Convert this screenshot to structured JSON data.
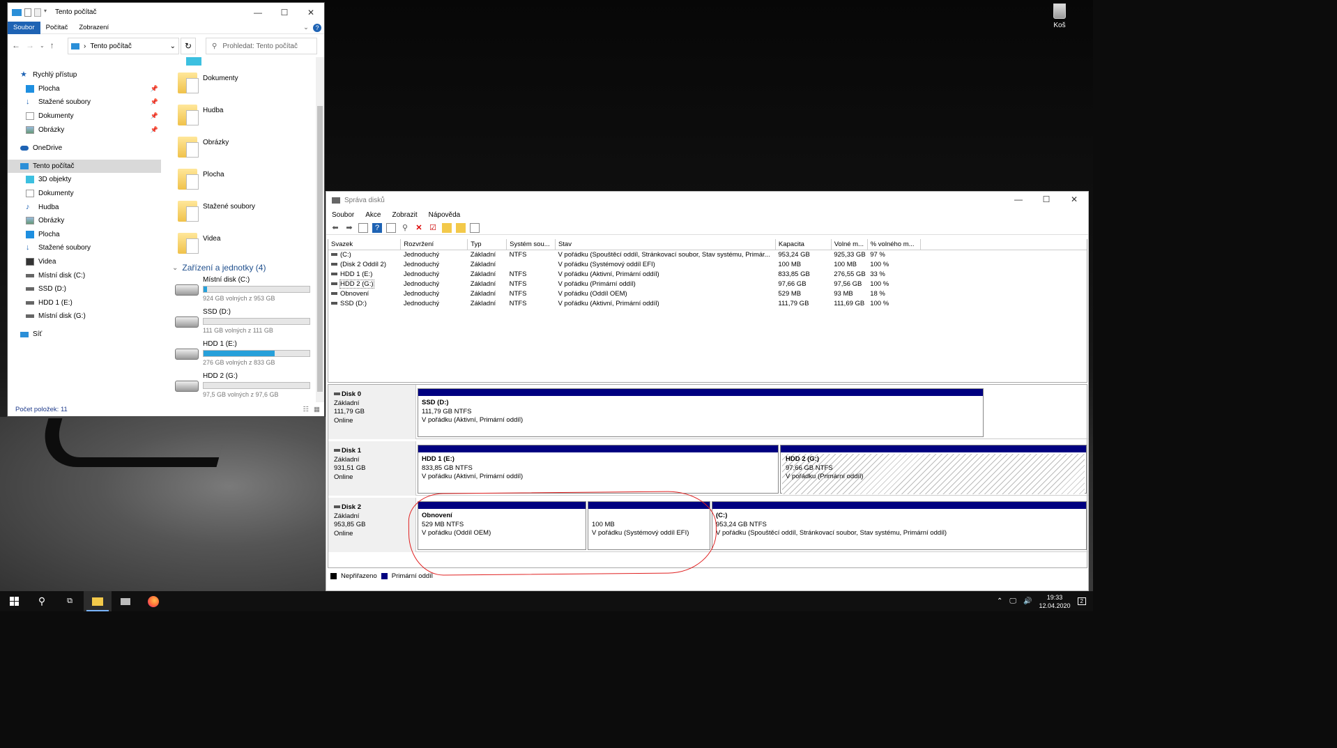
{
  "desktop": {
    "recycle_label": "Koš"
  },
  "explorer": {
    "title": "Tento počítač",
    "ribbon_tabs": [
      "Soubor",
      "Počítač",
      "Zobrazení"
    ],
    "address": "Tento počítač",
    "search_placeholder": "Prohledat: Tento počítač",
    "nav": {
      "quick_access": "Rychlý přístup",
      "quick_items": [
        "Plocha",
        "Stažené soubory",
        "Dokumenty",
        "Obrázky"
      ],
      "onedrive": "OneDrive",
      "this_pc": "Tento počítač",
      "pc_items": [
        "3D objekty",
        "Dokumenty",
        "Hudba",
        "Obrázky",
        "Plocha",
        "Stažené soubory",
        "Videa",
        "Místní disk (C:)",
        "SSD (D:)",
        "HDD 1 (E:)",
        "Místní disk (G:)"
      ],
      "network": "Síť"
    },
    "folders": [
      "Dokumenty",
      "Hudba",
      "Obrázky",
      "Plocha",
      "Stažené soubory",
      "Videa"
    ],
    "devices_header": "Zařízení a jednotky (4)",
    "drives": [
      {
        "name": "Místní disk (C:)",
        "free": "924 GB volných z 953 GB",
        "used_fraction": 0.03
      },
      {
        "name": "SSD (D:)",
        "free": "111 GB volných z 111 GB",
        "used_fraction": 0.0
      },
      {
        "name": "HDD 1 (E:)",
        "free": "276 GB volných z 833 GB",
        "used_fraction": 0.67
      },
      {
        "name": "HDD 2 (G:)",
        "free": "97,5 GB volných z 97,6 GB",
        "used_fraction": 0.0
      }
    ],
    "status": "Počet položek: 11"
  },
  "diskmgmt": {
    "title": "Správa disků",
    "menu": [
      "Soubor",
      "Akce",
      "Zobrazit",
      "Nápověda"
    ],
    "columns": [
      "Svazek",
      "Rozvržení",
      "Typ",
      "Systém sou...",
      "Stav",
      "Kapacita",
      "Volné m...",
      "% volného m..."
    ],
    "rows": [
      [
        "(C:)",
        "Jednoduchý",
        "Základní",
        "NTFS",
        "V pořádku (Spouštěcí oddíl, Stránkovací soubor, Stav systému, Primár...",
        "953,24 GB",
        "925,33 GB",
        "97 %"
      ],
      [
        "(Disk 2 Oddíl 2)",
        "Jednoduchý",
        "Základní",
        "",
        "V pořádku (Systémový oddíl EFI)",
        "100 MB",
        "100 MB",
        "100 %"
      ],
      [
        "HDD 1 (E:)",
        "Jednoduchý",
        "Základní",
        "NTFS",
        "V pořádku (Aktivní, Primární oddíl)",
        "833,85 GB",
        "276,55 GB",
        "33 %"
      ],
      [
        "HDD 2 (G:)",
        "Jednoduchý",
        "Základní",
        "NTFS",
        "V pořádku (Primární oddíl)",
        "97,66 GB",
        "97,56 GB",
        "100 %"
      ],
      [
        "Obnovení",
        "Jednoduchý",
        "Základní",
        "NTFS",
        "V pořádku (Oddíl OEM)",
        "529 MB",
        "93 MB",
        "18 %"
      ],
      [
        "SSD (D:)",
        "Jednoduchý",
        "Základní",
        "NTFS",
        "V pořádku (Aktivní, Primární oddíl)",
        "111,79 GB",
        "111,69 GB",
        "100 %"
      ]
    ],
    "disks": [
      {
        "name": "Disk 0",
        "type": "Základní",
        "size": "111,79 GB",
        "state": "Online",
        "parts": [
          {
            "title": "SSD  (D:)",
            "size": "111,79 GB NTFS",
            "status": "V pořádku (Aktivní, Primární oddíl)"
          }
        ]
      },
      {
        "name": "Disk 1",
        "type": "Základní",
        "size": "931,51 GB",
        "state": "Online",
        "parts": [
          {
            "title": "HDD 1  (E:)",
            "size": "833,85 GB NTFS",
            "status": "V pořádku (Aktivní, Primární oddíl)"
          },
          {
            "title": "HDD 2  (G:)",
            "size": "97,66 GB NTFS",
            "status": "V pořádku (Primární oddíl)"
          }
        ]
      },
      {
        "name": "Disk 2",
        "type": "Základní",
        "size": "953,85 GB",
        "state": "Online",
        "parts": [
          {
            "title": "Obnovení",
            "size": "529 MB NTFS",
            "status": "V pořádku (Oddíl OEM)"
          },
          {
            "title": "",
            "size": "100 MB",
            "status": "V pořádku (Systémový oddíl EFI)"
          },
          {
            "title": "(C:)",
            "size": "953,24 GB NTFS",
            "status": "V pořádku (Spouštěcí oddíl, Stránkovací soubor, Stav systému, Primární oddíl)"
          }
        ]
      }
    ],
    "legend": [
      "Nepřiřazeno",
      "Primární oddíl"
    ],
    "colors": {
      "primary": "#000080",
      "unallocated": "#000000",
      "annotation": "#e02020"
    }
  },
  "taskbar": {
    "time": "19:33",
    "date": "12.04.2020",
    "notifications": "2"
  }
}
